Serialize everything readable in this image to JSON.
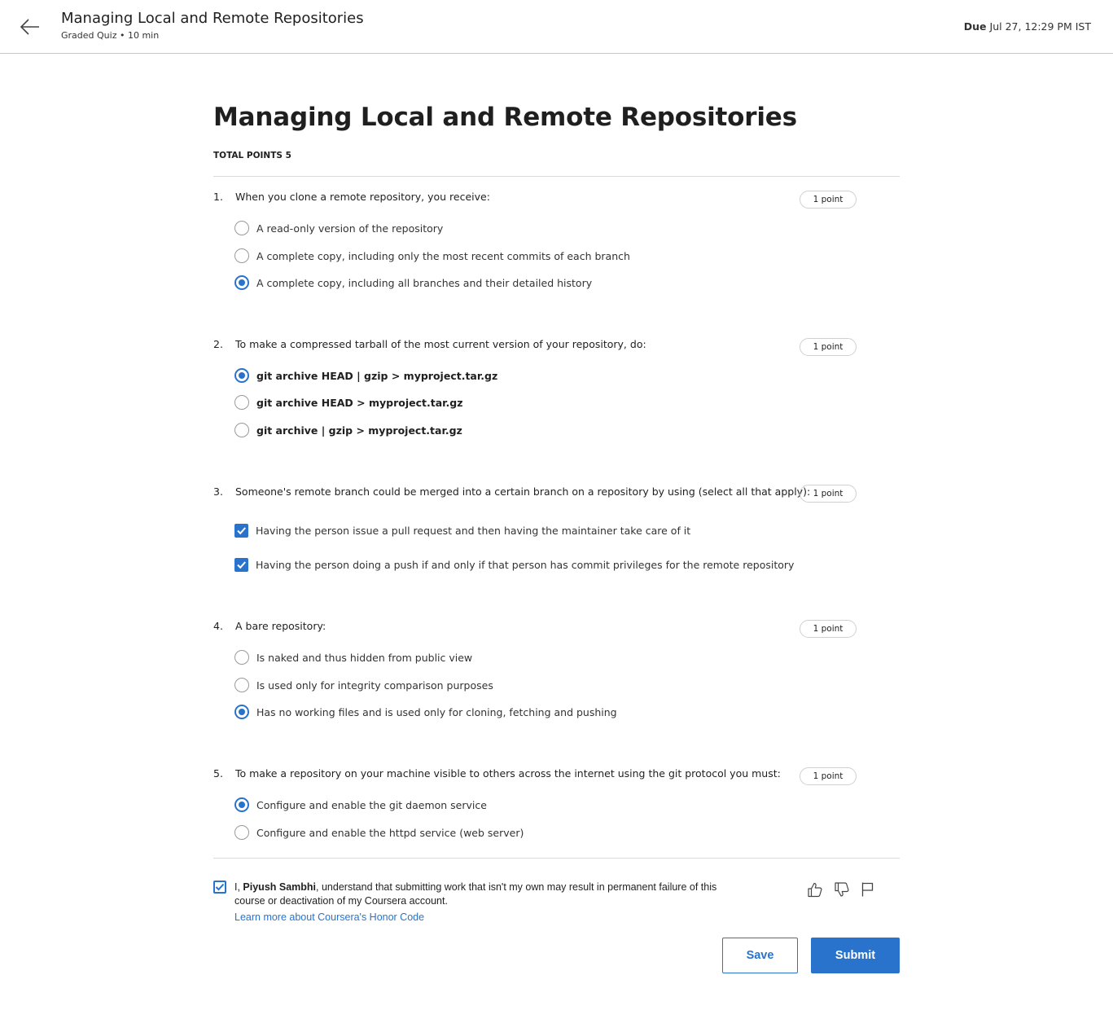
{
  "header": {
    "title": "Managing Local and Remote Repositories",
    "subtitle": "Graded Quiz • 10 min",
    "due_label": "Due",
    "due_value": "Jul 27, 12:29 PM IST"
  },
  "quiz": {
    "title": "Managing Local and Remote Repositories",
    "total_points": "TOTAL POINTS 5"
  },
  "questions": [
    {
      "number": "1.",
      "text": "When you clone a remote repository, you receive:",
      "points": "1 point",
      "type": "radio",
      "options": [
        {
          "label": "A read-only version of the repository",
          "selected": false
        },
        {
          "label": "A complete copy, including only the most recent commits of each branch",
          "selected": false
        },
        {
          "label": "A complete copy, including all branches and their detailed history",
          "selected": true
        }
      ]
    },
    {
      "number": "2.",
      "text": "To make a compressed tarball of the most current version of your repository, do:",
      "points": "1 point",
      "type": "radio",
      "options": [
        {
          "label": "git archive HEAD | gzip > myproject.tar.gz",
          "selected": true
        },
        {
          "label": "git archive HEAD > myproject.tar.gz",
          "selected": false
        },
        {
          "label": "git archive | gzip > myproject.tar.gz",
          "selected": false
        }
      ]
    },
    {
      "number": "3.",
      "text": "Someone's remote branch could be merged into a certain branch on a repository by using (select all that apply):",
      "points": "1 point",
      "type": "checkbox",
      "options": [
        {
          "label": "Having the person issue a pull request and then having the maintainer take care of it",
          "selected": true
        },
        {
          "label": "Having the person doing a push if and only if that person has commit privileges for the remote repository",
          "selected": true
        }
      ]
    },
    {
      "number": "4.",
      "text": "A bare repository:",
      "points": "1 point",
      "type": "radio",
      "options": [
        {
          "label": "Is naked and thus hidden from public view",
          "selected": false
        },
        {
          "label": "Is used only for integrity comparison purposes",
          "selected": false
        },
        {
          "label": "Has no working files and is used only for cloning, fetching and pushing",
          "selected": true
        }
      ]
    },
    {
      "number": "5.",
      "text": "To make a repository on your machine visible to others across the internet using the git protocol you must:",
      "points": "1 point",
      "type": "radio",
      "options": [
        {
          "label": "Configure and enable the git daemon service",
          "selected": true
        },
        {
          "label": "Configure and enable the httpd service (web server)",
          "selected": false
        }
      ]
    }
  ],
  "honor": {
    "prefix": "I, ",
    "name": "Piyush Sambhi",
    "suffix": ", understand that submitting work that isn't my own may result in permanent failure of this course or deactivation of my Coursera account.",
    "link": "Learn more about Coursera's Honor Code",
    "checked": true
  },
  "actions": {
    "save": "Save",
    "submit": "Submit"
  },
  "icons": [
    "back-arrow-icon",
    "thumbs-up-icon",
    "thumbs-down-icon",
    "flag-icon"
  ],
  "colors": {
    "accent": "#2a73cc"
  }
}
